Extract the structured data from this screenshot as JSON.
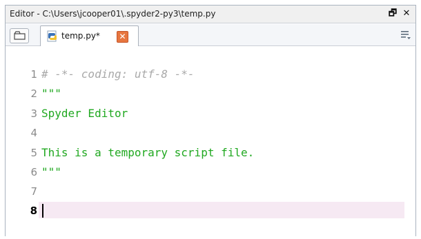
{
  "pane": {
    "title": "Editor - C:\\Users\\jcooper01\\.spyder2-py3\\temp.py",
    "undock_glyph": "🗗",
    "close_glyph": "✕"
  },
  "tabs": [
    {
      "label": "temp.py*",
      "icon": "python-file-icon",
      "close_glyph": "✕",
      "active": true
    }
  ],
  "editor": {
    "current_line": 8,
    "lines": [
      {
        "number": "1",
        "text": "# -*- coding: utf-8 -*-",
        "style": "comment"
      },
      {
        "number": "2",
        "text": "\"\"\"",
        "style": "string"
      },
      {
        "number": "3",
        "text": "Spyder Editor",
        "style": "string"
      },
      {
        "number": "4",
        "text": "",
        "style": "string"
      },
      {
        "number": "5",
        "text": "This is a temporary script file.",
        "style": "string"
      },
      {
        "number": "6",
        "text": "\"\"\"",
        "style": "string"
      },
      {
        "number": "7",
        "text": "",
        "style": "string"
      },
      {
        "number": "8",
        "text": "",
        "style": "string"
      }
    ]
  },
  "colors": {
    "string": "#20a820",
    "comment": "#a9a9a9",
    "current_line_bg": "#f6e9f3",
    "tab_close_bg": "#e7763f"
  }
}
